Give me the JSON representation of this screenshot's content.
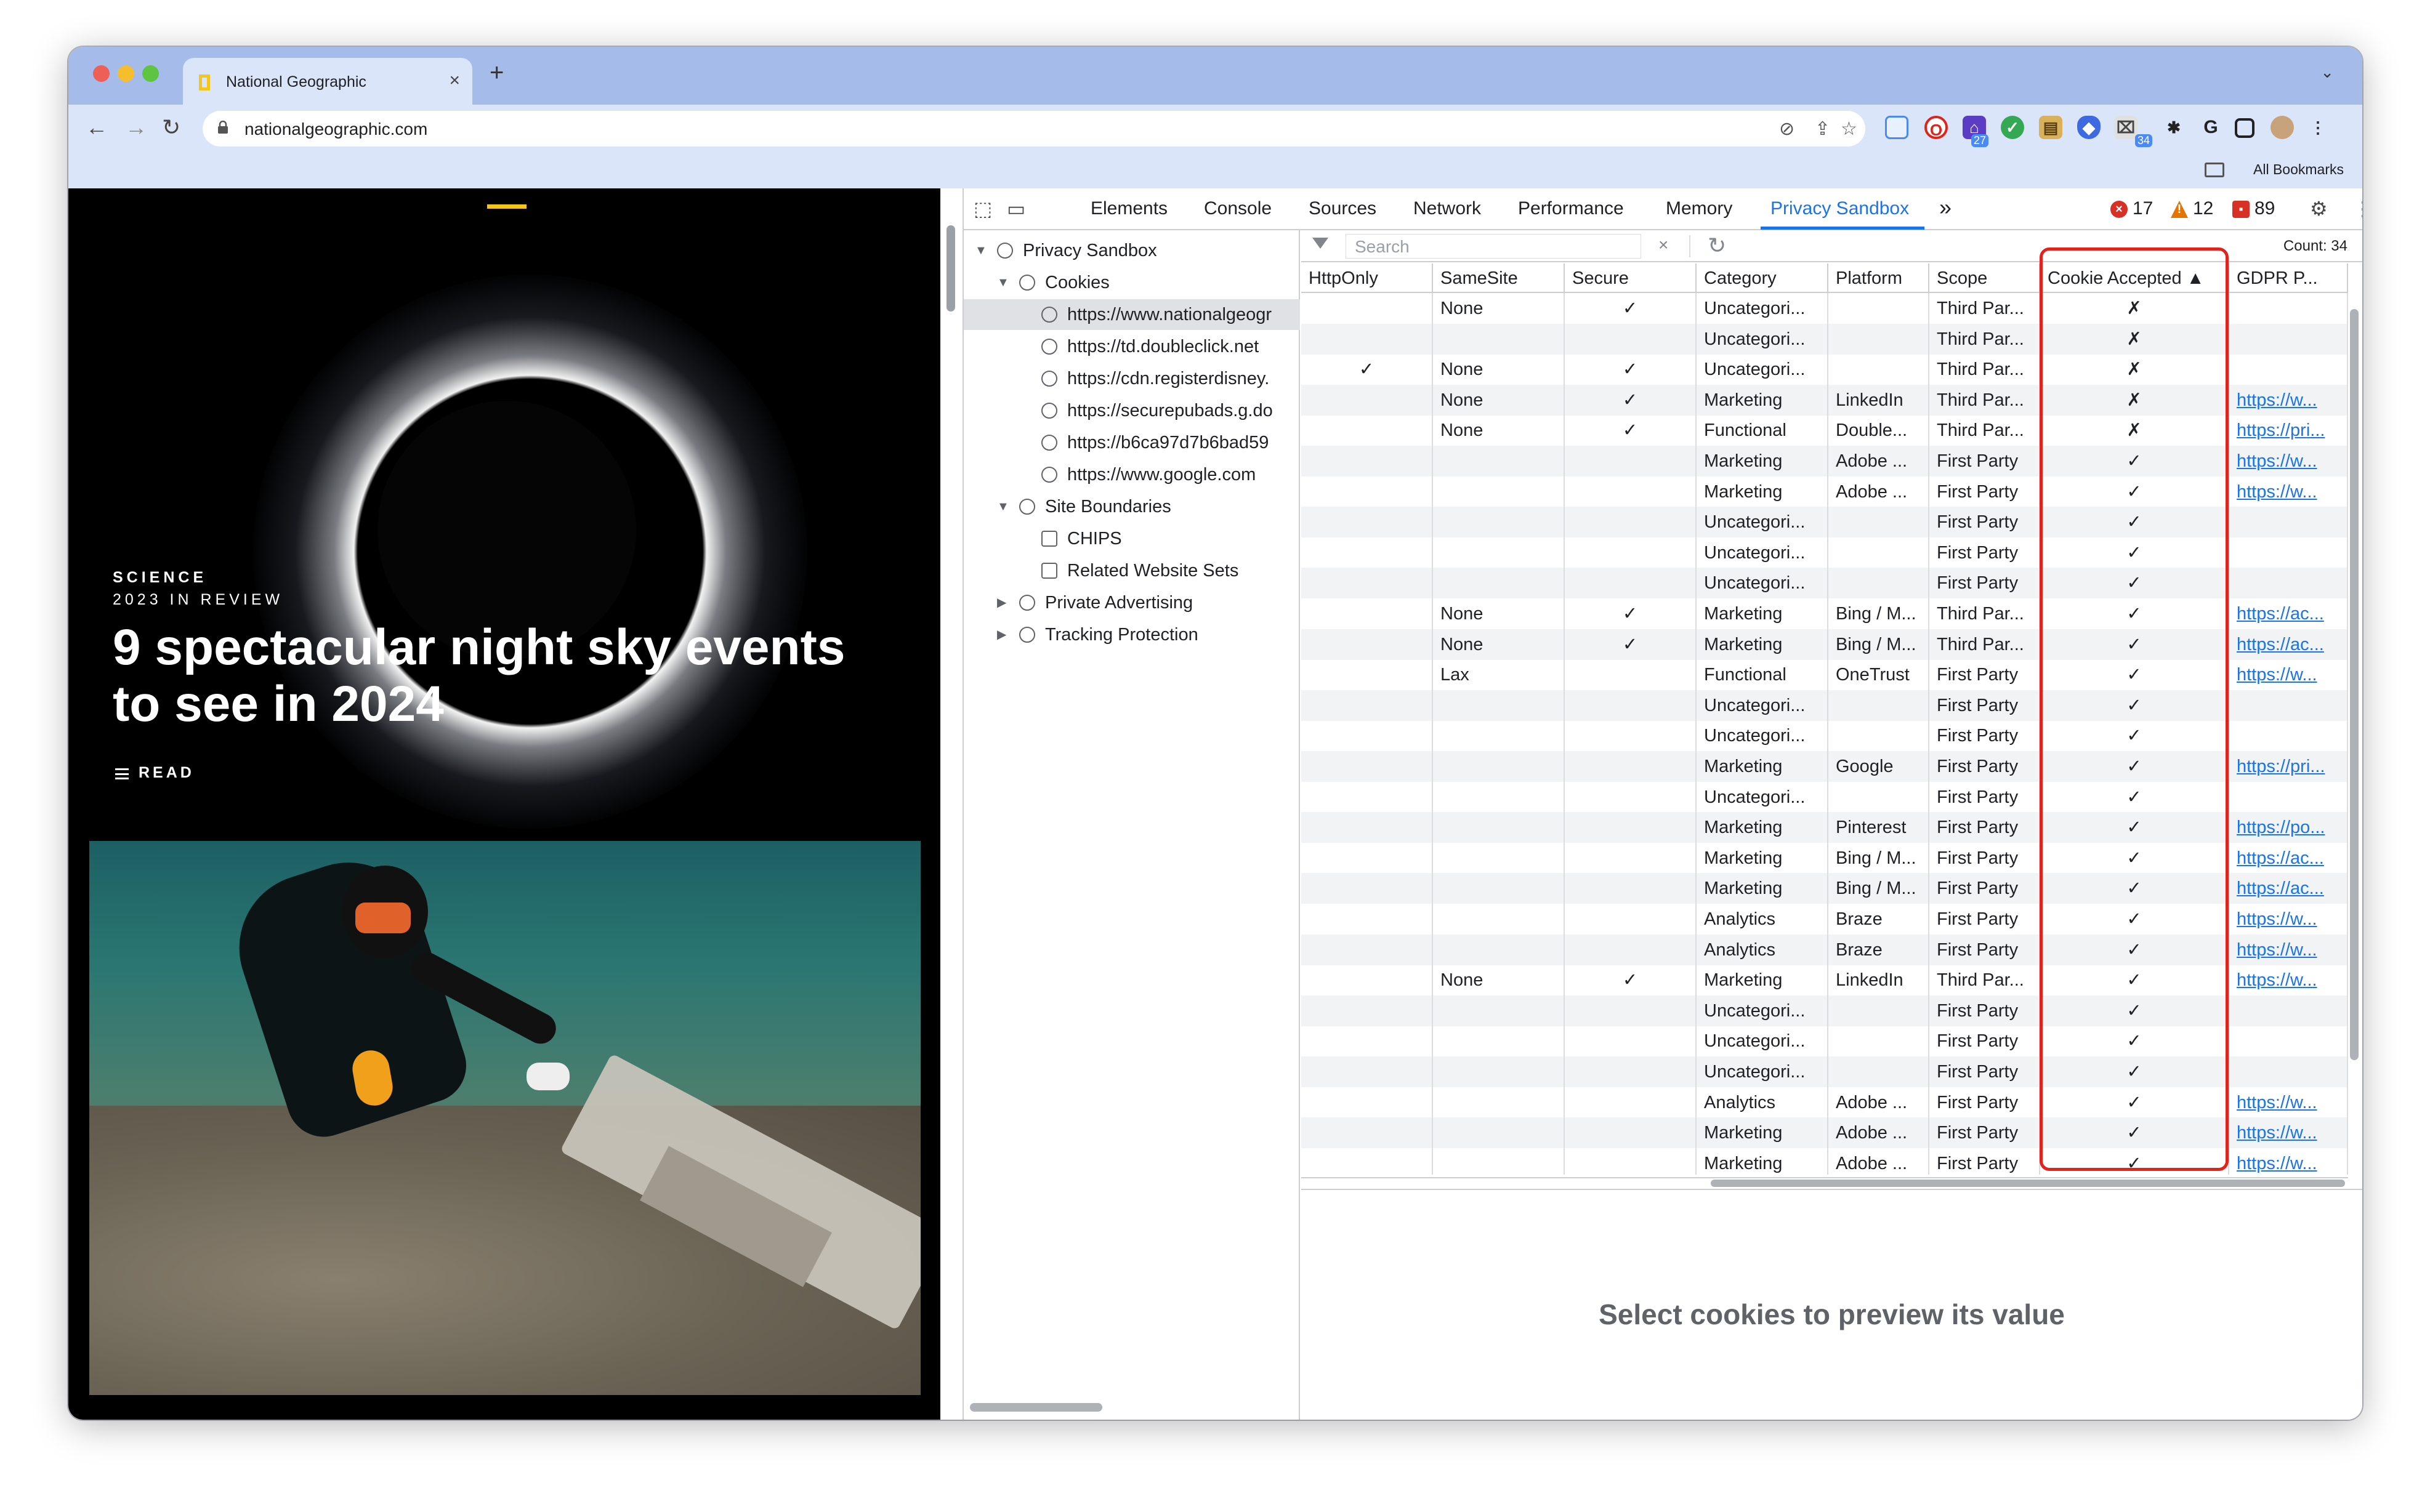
{
  "browser": {
    "tab_title": "National Geographic",
    "tab_close": "×",
    "new_tab": "+",
    "tab_menu": "⌄",
    "url": "nationalgeographic.com",
    "bookmarks_label": "All Bookmarks",
    "extension_badges": [
      "27",
      "34"
    ]
  },
  "page": {
    "kicker": "SCIENCE",
    "subkicker": "2023 IN REVIEW",
    "headline": "9 spectacular night sky events to see in 2024",
    "read_label": "READ"
  },
  "devtools": {
    "tabs": [
      {
        "label": "Elements"
      },
      {
        "label": "Console"
      },
      {
        "label": "Sources"
      },
      {
        "label": "Network"
      },
      {
        "label": "Performance"
      },
      {
        "label": "Memory"
      },
      {
        "label": "Privacy Sandbox"
      }
    ],
    "more_tabs": "»",
    "errors": "17",
    "warnings": "12",
    "issues": "89",
    "accent": "#1a73e8",
    "tree": [
      {
        "label": "Privacy Sandbox",
        "level": 0,
        "expanded": "open"
      },
      {
        "label": "Cookies",
        "level": 1,
        "expanded": "open"
      },
      {
        "label": "https://www.nationalgeogr",
        "level": 2,
        "selected": true
      },
      {
        "label": "https://td.doubleclick.net",
        "level": 2
      },
      {
        "label": "https://cdn.registerdisney.",
        "level": 2
      },
      {
        "label": "https://securepubads.g.do",
        "level": 2
      },
      {
        "label": "https://b6ca97d7b6bad59",
        "level": 2
      },
      {
        "label": "https://www.google.com",
        "level": 2
      },
      {
        "label": "Site Boundaries",
        "level": 1,
        "expanded": "open"
      },
      {
        "label": "CHIPS",
        "level": 2
      },
      {
        "label": "Related Website Sets",
        "level": 2
      },
      {
        "label": "Private Advertising",
        "level": 1,
        "expanded": "closed"
      },
      {
        "label": "Tracking Protection",
        "level": 1,
        "expanded": "closed"
      }
    ],
    "filter": {
      "placeholder": "Search",
      "clear": "×",
      "count": "Count: 34"
    },
    "columns": [
      "HttpOnly",
      "SameSite",
      "Secure",
      "Category",
      "Platform",
      "Scope",
      "Cookie Accepted ▲",
      "GDPR P..."
    ],
    "rows": [
      [
        "",
        "None",
        "✓",
        "Uncategori...",
        "",
        "Third Par...",
        "✗",
        ""
      ],
      [
        "",
        "",
        "",
        "Uncategori...",
        "",
        "Third Par...",
        "✗",
        ""
      ],
      [
        "✓",
        "None",
        "✓",
        "Uncategori...",
        "",
        "Third Par...",
        "✗",
        ""
      ],
      [
        "",
        "None",
        "✓",
        "Marketing",
        "LinkedIn",
        "Third Par...",
        "✗",
        "https://w..."
      ],
      [
        "",
        "None",
        "✓",
        "Functional",
        "Double...",
        "Third Par...",
        "✗",
        "https://pri..."
      ],
      [
        "",
        "",
        "",
        "Marketing",
        "Adobe ...",
        "First Party",
        "✓",
        "https://w..."
      ],
      [
        "",
        "",
        "",
        "Marketing",
        "Adobe ...",
        "First Party",
        "✓",
        "https://w..."
      ],
      [
        "",
        "",
        "",
        "Uncategori...",
        "",
        "First Party",
        "✓",
        ""
      ],
      [
        "",
        "",
        "",
        "Uncategori...",
        "",
        "First Party",
        "✓",
        ""
      ],
      [
        "",
        "",
        "",
        "Uncategori...",
        "",
        "First Party",
        "✓",
        ""
      ],
      [
        "",
        "None",
        "✓",
        "Marketing",
        "Bing / M...",
        "Third Par...",
        "✓",
        "https://ac..."
      ],
      [
        "",
        "None",
        "✓",
        "Marketing",
        "Bing / M...",
        "Third Par...",
        "✓",
        "https://ac..."
      ],
      [
        "",
        "Lax",
        "",
        "Functional",
        "OneTrust",
        "First Party",
        "✓",
        "https://w..."
      ],
      [
        "",
        "",
        "",
        "Uncategori...",
        "",
        "First Party",
        "✓",
        ""
      ],
      [
        "",
        "",
        "",
        "Uncategori...",
        "",
        "First Party",
        "✓",
        ""
      ],
      [
        "",
        "",
        "",
        "Marketing",
        "Google",
        "First Party",
        "✓",
        "https://pri..."
      ],
      [
        "",
        "",
        "",
        "Uncategori...",
        "",
        "First Party",
        "✓",
        ""
      ],
      [
        "",
        "",
        "",
        "Marketing",
        "Pinterest",
        "First Party",
        "✓",
        "https://po..."
      ],
      [
        "",
        "",
        "",
        "Marketing",
        "Bing / M...",
        "First Party",
        "✓",
        "https://ac..."
      ],
      [
        "",
        "",
        "",
        "Marketing",
        "Bing / M...",
        "First Party",
        "✓",
        "https://ac..."
      ],
      [
        "",
        "",
        "",
        "Analytics",
        "Braze",
        "First Party",
        "✓",
        "https://w..."
      ],
      [
        "",
        "",
        "",
        "Analytics",
        "Braze",
        "First Party",
        "✓",
        "https://w..."
      ],
      [
        "",
        "None",
        "✓",
        "Marketing",
        "LinkedIn",
        "Third Par...",
        "✓",
        "https://w..."
      ],
      [
        "",
        "",
        "",
        "Uncategori...",
        "",
        "First Party",
        "✓",
        ""
      ],
      [
        "",
        "",
        "",
        "Uncategori...",
        "",
        "First Party",
        "✓",
        ""
      ],
      [
        "",
        "",
        "",
        "Uncategori...",
        "",
        "First Party",
        "✓",
        ""
      ],
      [
        "",
        "",
        "",
        "Analytics",
        "Adobe ...",
        "First Party",
        "✓",
        "https://w..."
      ],
      [
        "",
        "",
        "",
        "Marketing",
        "Adobe ...",
        "First Party",
        "✓",
        "https://w..."
      ],
      [
        "",
        "",
        "",
        "Marketing",
        "Adobe ...",
        "First Party",
        "✓",
        "https://w..."
      ]
    ],
    "preview_message": "Select cookies to preview its value"
  }
}
